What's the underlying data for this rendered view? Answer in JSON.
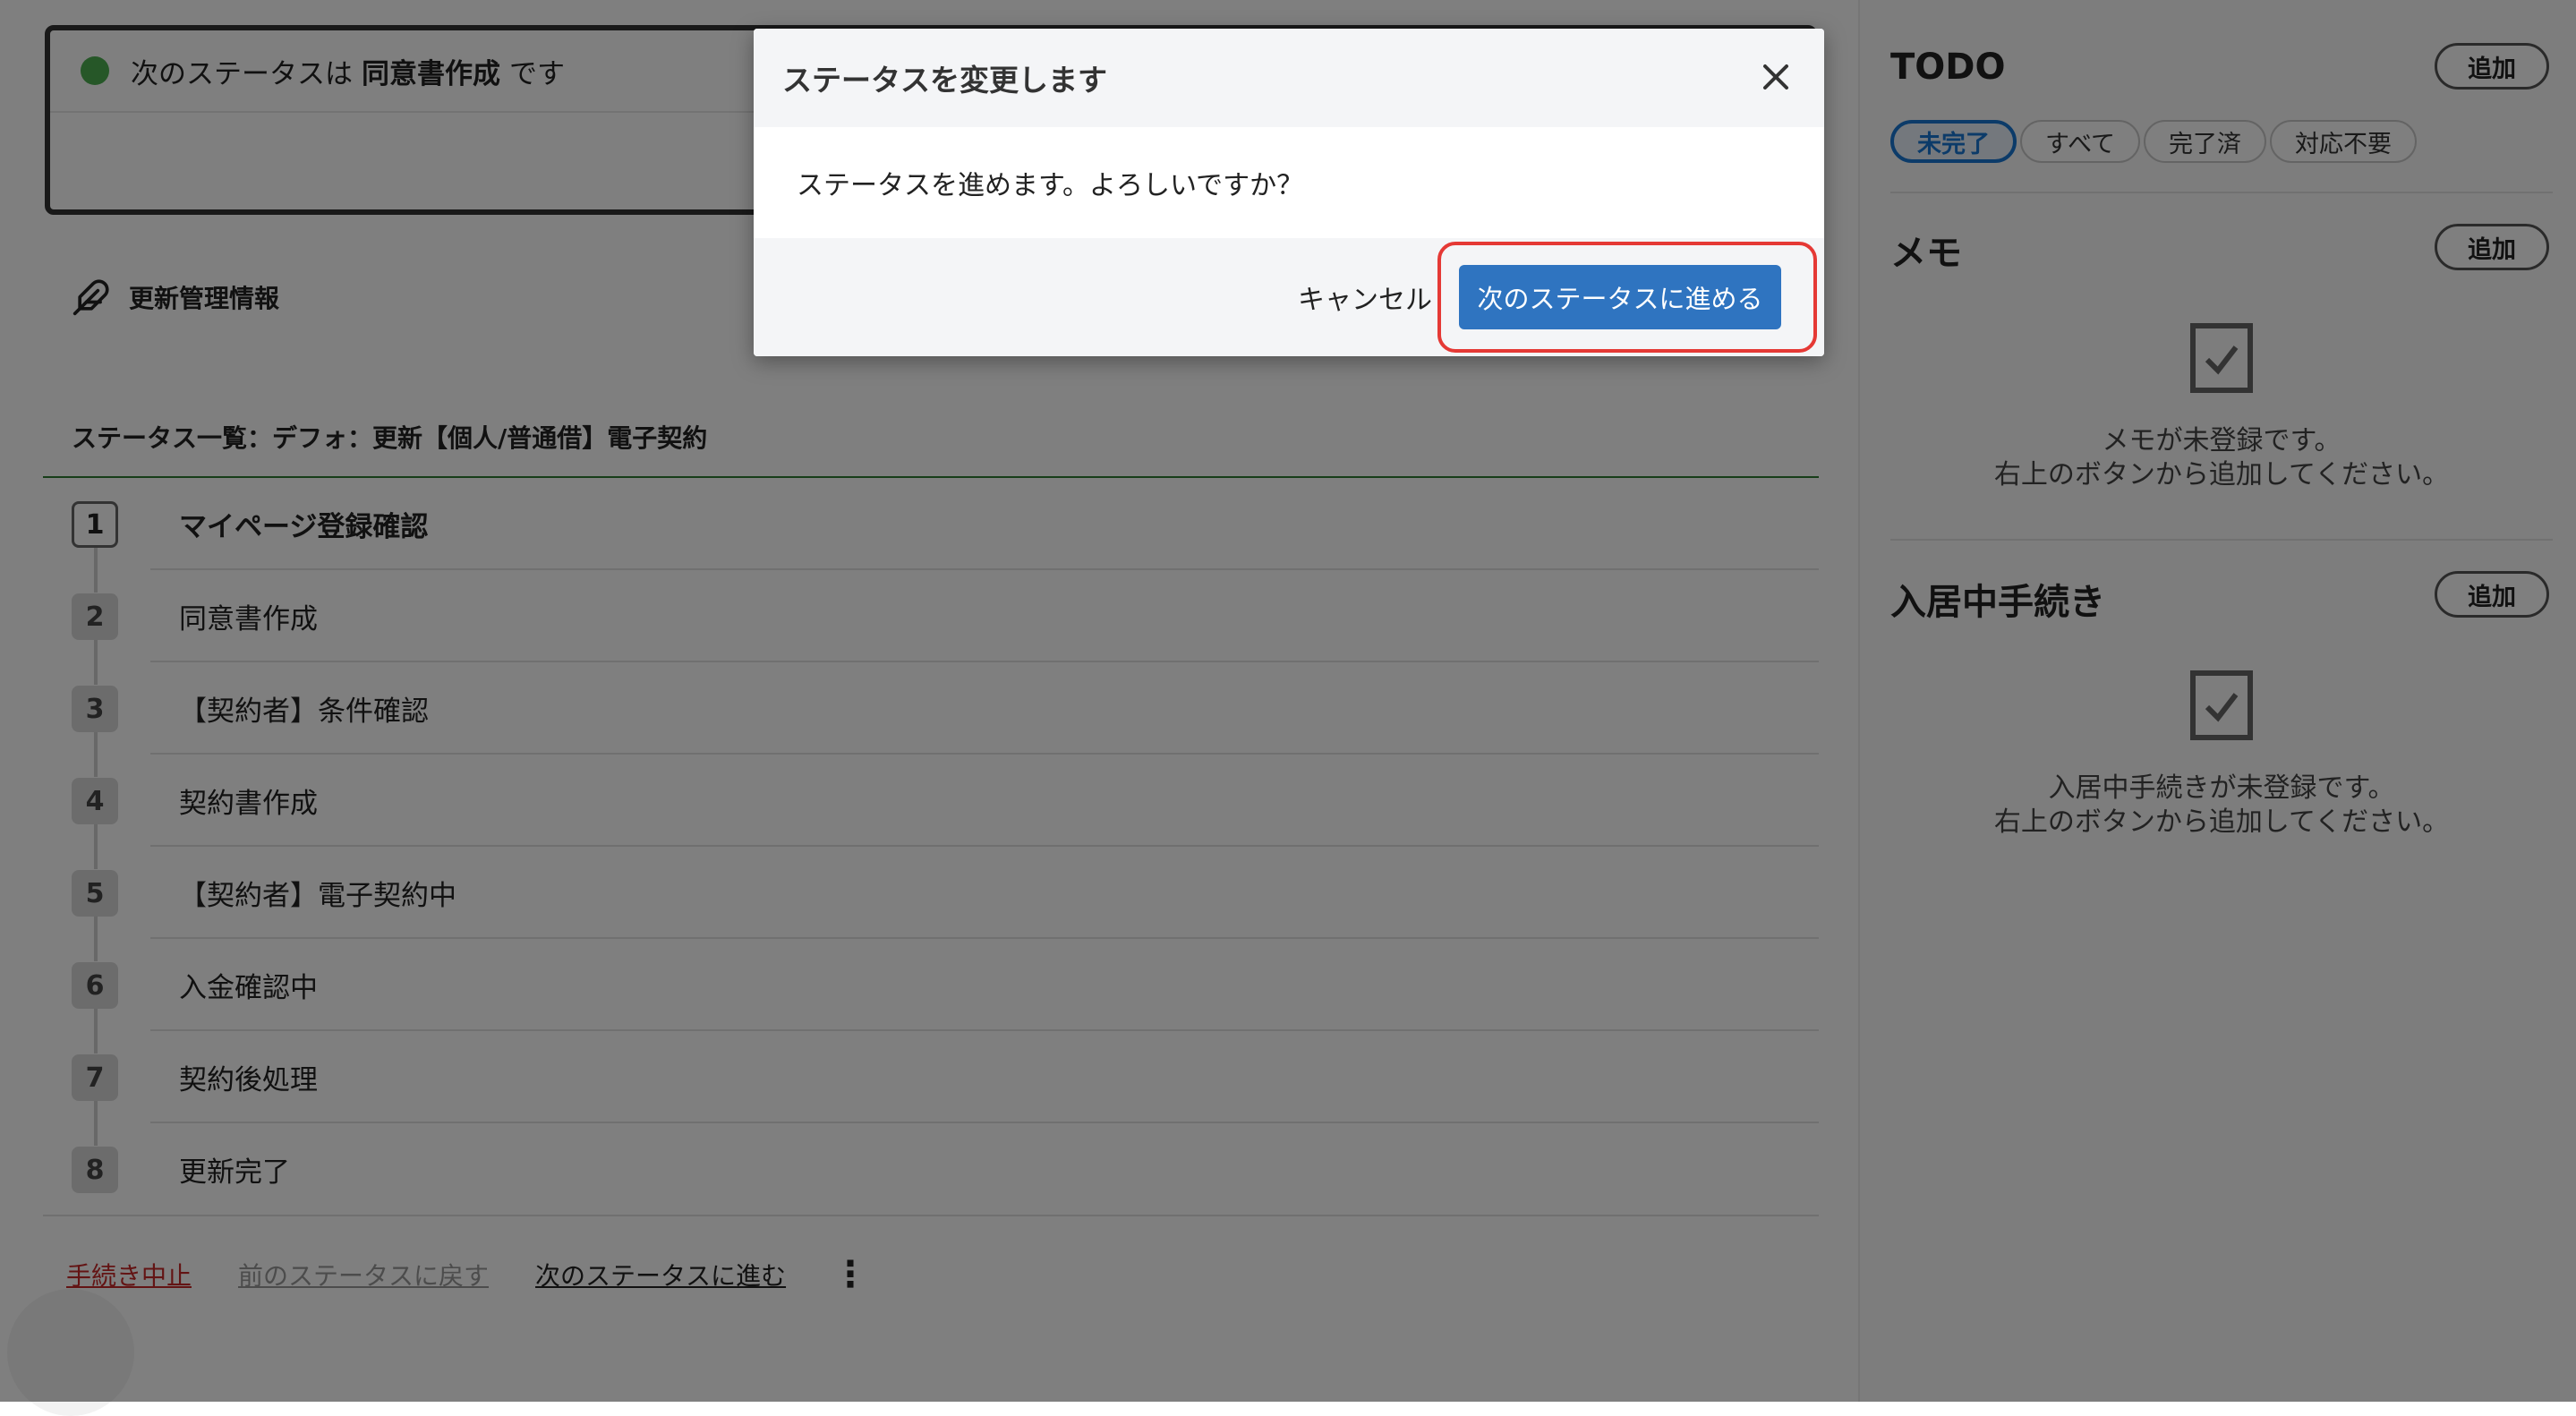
{
  "next_status": {
    "prefix": "次のステータスは",
    "status": "同意書作成",
    "suffix": "です",
    "dot_color": "#4caf50"
  },
  "renewal": {
    "icon": "feather-pen-icon",
    "label": "更新管理情報"
  },
  "status_list": {
    "title": "ステータス一覧：デフォ：更新【個人/普通借】電子契約",
    "steps": [
      {
        "num": "1",
        "label": "マイページ登録確認",
        "active": true
      },
      {
        "num": "2",
        "label": "同意書作成"
      },
      {
        "num": "3",
        "label": "【契約者】条件確認"
      },
      {
        "num": "4",
        "label": "契約書作成"
      },
      {
        "num": "5",
        "label": "【契約者】電子契約中"
      },
      {
        "num": "6",
        "label": "入金確認中"
      },
      {
        "num": "7",
        "label": "契約後処理"
      },
      {
        "num": "8",
        "label": "更新完了"
      }
    ]
  },
  "actions": {
    "abort": "手続き中止",
    "prev": "前のステータスに戻す",
    "next": "次のステータスに進む",
    "more_icon": "kebab-menu-icon",
    "more_glyph": "⋮"
  },
  "sidebar": {
    "todo": {
      "title": "TODO",
      "add": "追加",
      "filters": [
        "未完了",
        "すべて",
        "完了済",
        "対応不要"
      ],
      "active_filter": "未完了"
    },
    "memo": {
      "title": "メモ",
      "add": "追加",
      "empty_line1": "メモが未登録です。",
      "empty_line2": "右上のボタンから追加してください。"
    },
    "move_in": {
      "title": "入居中手続き",
      "add": "追加",
      "empty_line1": "入居中手続きが未登録です。",
      "empty_line2": "右上のボタンから追加してください。"
    }
  },
  "dialog": {
    "title": "ステータスを変更します",
    "message": "ステータスを進めます。よろしいですか？",
    "cancel": "キャンセル",
    "confirm": "次のステータスに進める",
    "confirm_color": "#2f74c0",
    "highlight_color": "#e53935"
  }
}
